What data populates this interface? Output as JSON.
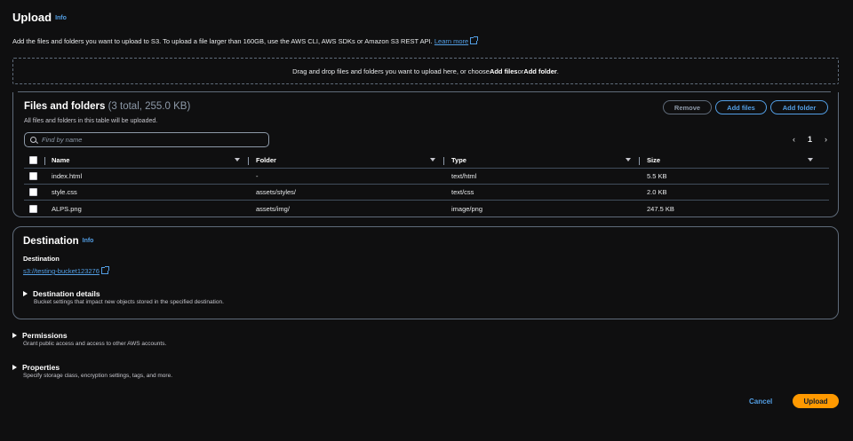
{
  "header": {
    "title": "Upload",
    "info_label": "Info",
    "description": "Add the files and folders you want to upload to S3. To upload a file larger than 160GB, use the AWS CLI, AWS SDKs or Amazon S3 REST API.",
    "learn_more": "Learn more"
  },
  "dropzone": {
    "text_before": "Drag and drop files and folders you want to upload here, or choose ",
    "add_files": "Add files",
    "text_middle": " or ",
    "add_folder": "Add folder",
    "text_end": "."
  },
  "files": {
    "title": "Files and folders",
    "count": "(3 total, 255.0 KB)",
    "subtitle": "All files and folders in this table will be uploaded.",
    "remove_label": "Remove",
    "add_files_label": "Add files",
    "add_folder_label": "Add folder",
    "search_placeholder": "Find by name",
    "page_number": "1",
    "columns": [
      "Name",
      "Folder",
      "Type",
      "Size"
    ],
    "rows": [
      {
        "name": "index.html",
        "folder": "-",
        "type": "text/html",
        "size": "5.5 KB"
      },
      {
        "name": "style.css",
        "folder": "assets/styles/",
        "type": "text/css",
        "size": "2.0 KB"
      },
      {
        "name": "ALPS.png",
        "folder": "assets/img/",
        "type": "image/png",
        "size": "247.5 KB"
      }
    ]
  },
  "destination": {
    "title": "Destination",
    "info_label": "Info",
    "label": "Destination",
    "bucket_link": "s3://testing-bucket123276",
    "details_title": "Destination details",
    "details_desc": "Bucket settings that impact new objects stored in the specified destination."
  },
  "permissions": {
    "title": "Permissions",
    "desc": "Grant public access and access to other AWS accounts."
  },
  "properties": {
    "title": "Properties",
    "desc": "Specify storage class, encryption settings, tags, and more."
  },
  "footer": {
    "cancel_label": "Cancel",
    "upload_label": "Upload"
  },
  "colors": {
    "background": "#0f0f10",
    "link": "#539fe5",
    "primary_button": "#ff9900",
    "border": "#5f6b7a"
  }
}
